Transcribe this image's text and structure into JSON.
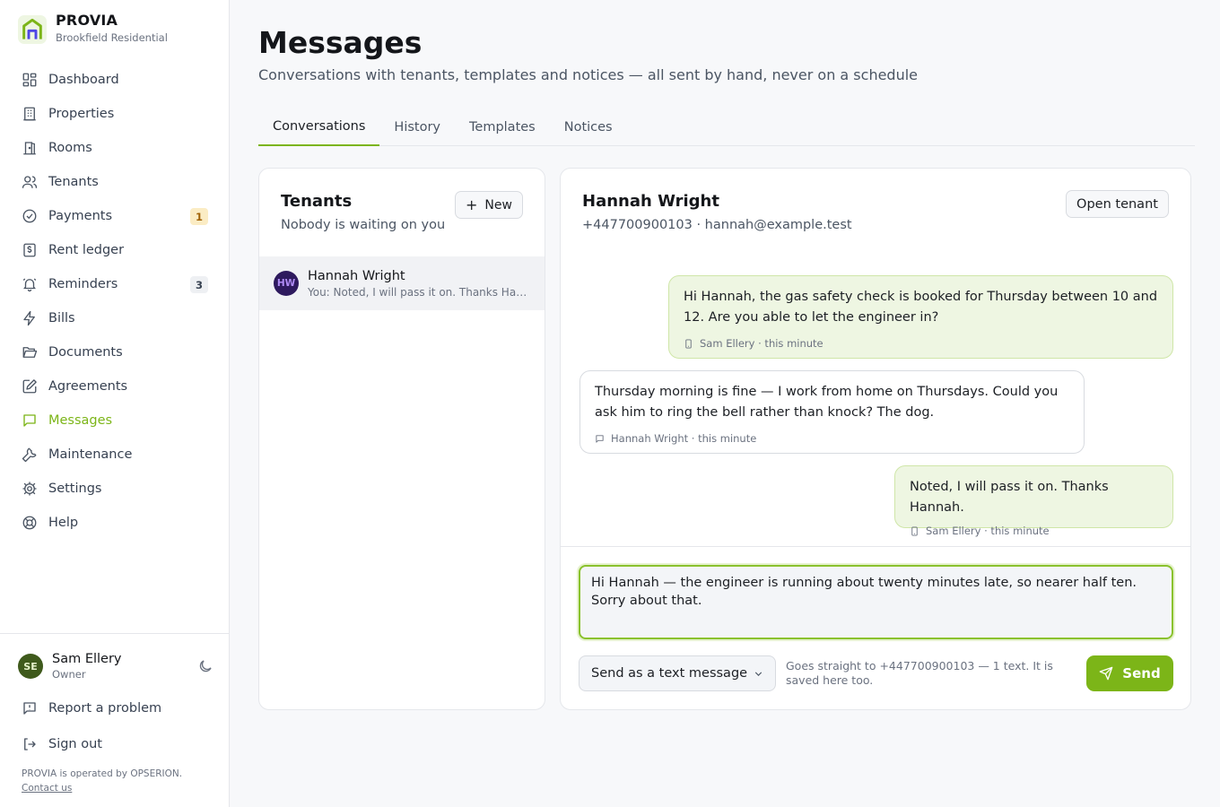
{
  "brand": {
    "name": "PROVIA",
    "subtitle": "Brookfield Residential"
  },
  "sidebar": {
    "items": [
      {
        "label": "Dashboard",
        "icon": "dashboard-icon"
      },
      {
        "label": "Properties",
        "icon": "building-icon"
      },
      {
        "label": "Rooms",
        "icon": "door-icon"
      },
      {
        "label": "Tenants",
        "icon": "users-icon"
      },
      {
        "label": "Payments",
        "icon": "check-circle-icon",
        "badge": "1"
      },
      {
        "label": "Rent ledger",
        "icon": "ledger-icon"
      },
      {
        "label": "Reminders",
        "icon": "bell-icon",
        "badge": "3"
      },
      {
        "label": "Bills",
        "icon": "bolt-icon"
      },
      {
        "label": "Documents",
        "icon": "folder-icon"
      },
      {
        "label": "Agreements",
        "icon": "pen-icon"
      },
      {
        "label": "Messages",
        "icon": "message-icon",
        "active": true
      },
      {
        "label": "Maintenance",
        "icon": "wrench-icon"
      },
      {
        "label": "Settings",
        "icon": "gear-icon"
      },
      {
        "label": "Help",
        "icon": "lifebuoy-icon"
      }
    ],
    "user": {
      "initials": "SE",
      "name": "Sam Ellery",
      "role": "Owner"
    },
    "report_label": "Report a problem",
    "signout_label": "Sign out",
    "footer_note": "PROVIA is operated by OPSERION.",
    "contact_label": "Contact us"
  },
  "page": {
    "title": "Messages",
    "subtitle": "Conversations with tenants, templates and notices — all sent by hand, never on a schedule"
  },
  "tabs": [
    {
      "label": "Conversations",
      "active": true
    },
    {
      "label": "History"
    },
    {
      "label": "Templates"
    },
    {
      "label": "Notices"
    }
  ],
  "tenants_panel": {
    "title": "Tenants",
    "subtitle": "Nobody is waiting on you",
    "new_label": "New",
    "conversations": [
      {
        "initials": "HW",
        "name": "Hannah Wright",
        "preview": "You: Noted, I will pass it on. Thanks Hannah."
      }
    ]
  },
  "chat": {
    "name": "Hannah Wright",
    "contact": "+447700900103 · hannah@example.test",
    "open_label": "Open tenant",
    "messages": [
      {
        "direction": "out",
        "text": "Hi Hannah, the gas safety check is booked for Thursday between 10 and 12. Are you able to let the engineer in?",
        "meta": "Sam Ellery · this minute",
        "channel_icon": "phone-icon"
      },
      {
        "direction": "in",
        "text": "Thursday morning is fine — I work from home on Thursdays. Could you ask him to ring the bell rather than knock? The dog.",
        "meta": "Hannah Wright · this minute",
        "channel_icon": "message-icon"
      },
      {
        "direction": "out",
        "text": "Noted, I will pass it on. Thanks Hannah.",
        "meta": "Sam Ellery · this minute",
        "channel_icon": "phone-icon"
      }
    ],
    "composer_value": "Hi Hannah — the engineer is running about twenty minutes late, so nearer half ten. Sorry about that.",
    "channel_select": "Send as a text message",
    "hint": "Goes straight to +447700900103 — 1 text. It is saved here too.",
    "send_label": "Send"
  },
  "colors": {
    "accent": "#7cb518",
    "out_bubble": "#eef6e2",
    "badge_amber": "#fbecc4"
  }
}
